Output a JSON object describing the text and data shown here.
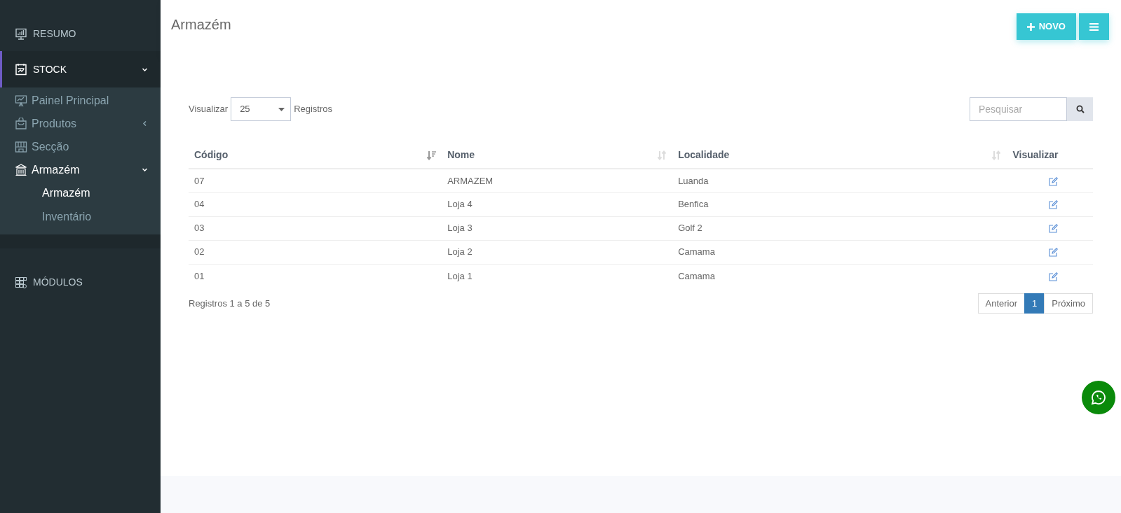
{
  "sidebar": {
    "items": [
      {
        "label": "RESUMO",
        "selected": false
      },
      {
        "label": "STOCK",
        "selected": true,
        "expanded": true,
        "children": [
          {
            "label": "Painel Principal",
            "selected": false
          },
          {
            "label": "Produtos",
            "selected": false,
            "expanded": false
          },
          {
            "label": "Secção",
            "selected": false
          },
          {
            "label": "Armazém",
            "selected": true,
            "expanded": true,
            "children": [
              {
                "label": "Armazém",
                "selected": true
              },
              {
                "label": "Inventário",
                "selected": false
              }
            ]
          }
        ]
      },
      {
        "label": "MÓDULOS",
        "selected": false
      }
    ]
  },
  "header": {
    "title": "Armazém",
    "new_button": "NOVO"
  },
  "length_control": {
    "prefix": "Visualizar",
    "value": "25",
    "suffix": "Registros"
  },
  "search": {
    "placeholder": "Pesquisar"
  },
  "table": {
    "columns": [
      {
        "label": "Código",
        "sorted": true
      },
      {
        "label": "Nome",
        "sorted": false
      },
      {
        "label": "Localidade",
        "sorted": false
      },
      {
        "label": "Visualizar"
      }
    ],
    "rows": [
      {
        "code": "07",
        "name": "ARMAZEM",
        "location": "Luanda"
      },
      {
        "code": "04",
        "name": "Loja 4",
        "location": "Benfica"
      },
      {
        "code": "03",
        "name": "Loja 3",
        "location": "Golf 2"
      },
      {
        "code": "02",
        "name": "Loja 2",
        "location": "Camama"
      },
      {
        "code": "01",
        "name": "Loja 1",
        "location": "Camama"
      }
    ]
  },
  "info": "Registros 1 a 5 de 5",
  "pagination": [
    {
      "label": "Anterior",
      "selected": false
    },
    {
      "label": "1",
      "selected": true
    },
    {
      "label": "Próximo",
      "selected": false
    }
  ]
}
